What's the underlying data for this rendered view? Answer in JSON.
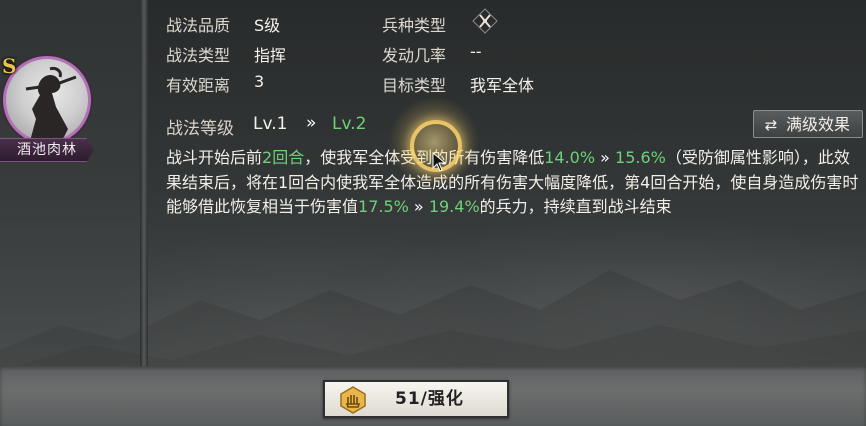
{
  "hero": {
    "rank": "S",
    "name": "酒池肉林"
  },
  "attributes": {
    "quality_label": "战法品质",
    "quality_value": "S级",
    "type_label": "战法类型",
    "type_value": "指挥",
    "range_label": "有效距离",
    "range_value": "3",
    "troop_label": "兵种类型",
    "trigger_label": "发动几率",
    "trigger_value": "--",
    "target_label": "目标类型",
    "target_value": "我军全体"
  },
  "level": {
    "label": "战法等级",
    "current": "Lv.1",
    "arrow": "»",
    "next": "Lv.2",
    "max_effect_button": "满级效果"
  },
  "description": {
    "p1": "战斗开始后前",
    "v1": "2回合",
    "p2": "，使我军全体受到的所有伤害降低",
    "v2": "14.0%",
    "a1": " » ",
    "v3": "15.6%",
    "p3": "（受防御属性影响），此效果结束后，将在1回合内使我军全体造成的所有伤害大幅度降低，第4回合开始，使自身造成伤害时能够借此恢复相当于伤害值",
    "v4": "17.5%",
    "a2": " » ",
    "v5": "19.4%",
    "p4": "的兵力，持续直到战斗结束"
  },
  "enhance": {
    "label": "51/强化"
  },
  "colors": {
    "highlight_green": "#6fd07a",
    "avatar_border": "#b46fb6",
    "rank_gold": "#e8c24b"
  },
  "icons": {
    "troop": "crossed-weapons-icon",
    "swap": "swap-arrows-icon",
    "enhance": "enhance-hand-icon"
  }
}
